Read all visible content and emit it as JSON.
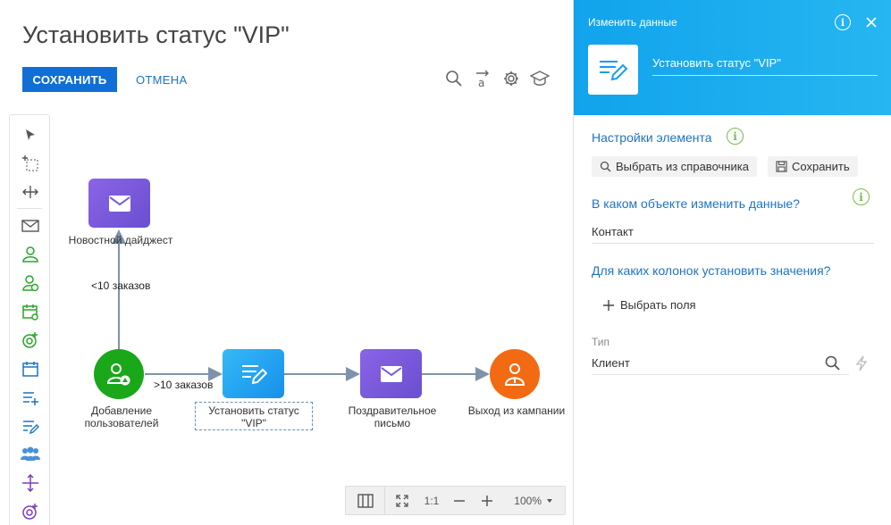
{
  "header": {
    "title": "Установить статус \"VIP\"",
    "save_label": "СОХРАНИТЬ",
    "cancel_label": "ОТМЕНА"
  },
  "toolbar_icons": [
    "search-icon",
    "text-format-icon",
    "gear-icon",
    "academy-icon"
  ],
  "toolbox_icons": [
    "pointer-icon",
    "lasso-icon",
    "connect-icon",
    "envelope-icon",
    "contact-add-icon",
    "contact-group-icon",
    "calendar-user-icon",
    "target-icon",
    "calendar-icon",
    "list-add-icon",
    "list-edit-icon",
    "users-group-icon",
    "move-icon",
    "target-plus-icon"
  ],
  "canvas": {
    "nodes": {
      "digest": {
        "label": "Новостной дайджест",
        "color": "#7b5bd9"
      },
      "add_users": {
        "label": "Добавление пользователей",
        "color": "#1aa81a"
      },
      "set_vip": {
        "label": "Установить статус \"VIP\"",
        "color": "#1b9cf0"
      },
      "congrats": {
        "label": "Поздравительное письмо",
        "color": "#7b5bd9"
      },
      "exit": {
        "label": "Выход из кампании",
        "color": "#f26b12"
      }
    },
    "edges": {
      "less10": "<10 заказов",
      "more10": ">10 заказов"
    }
  },
  "zoombar": {
    "ratio": "1:1",
    "zoom": "100%"
  },
  "panel": {
    "head_title": "Изменить данные",
    "element_name": "Установить статус \"VIP\"",
    "settings_title": "Настройки элемента",
    "pick_button": "Выбрать из справочника",
    "save_button": "Сохранить",
    "object_question": "В каком объекте изменить данные?",
    "object_value": "Контакт",
    "columns_question": "Для каких колонок установить значения?",
    "pick_fields": "Выбрать поля",
    "type_label": "Тип",
    "type_value": "Клиент"
  }
}
